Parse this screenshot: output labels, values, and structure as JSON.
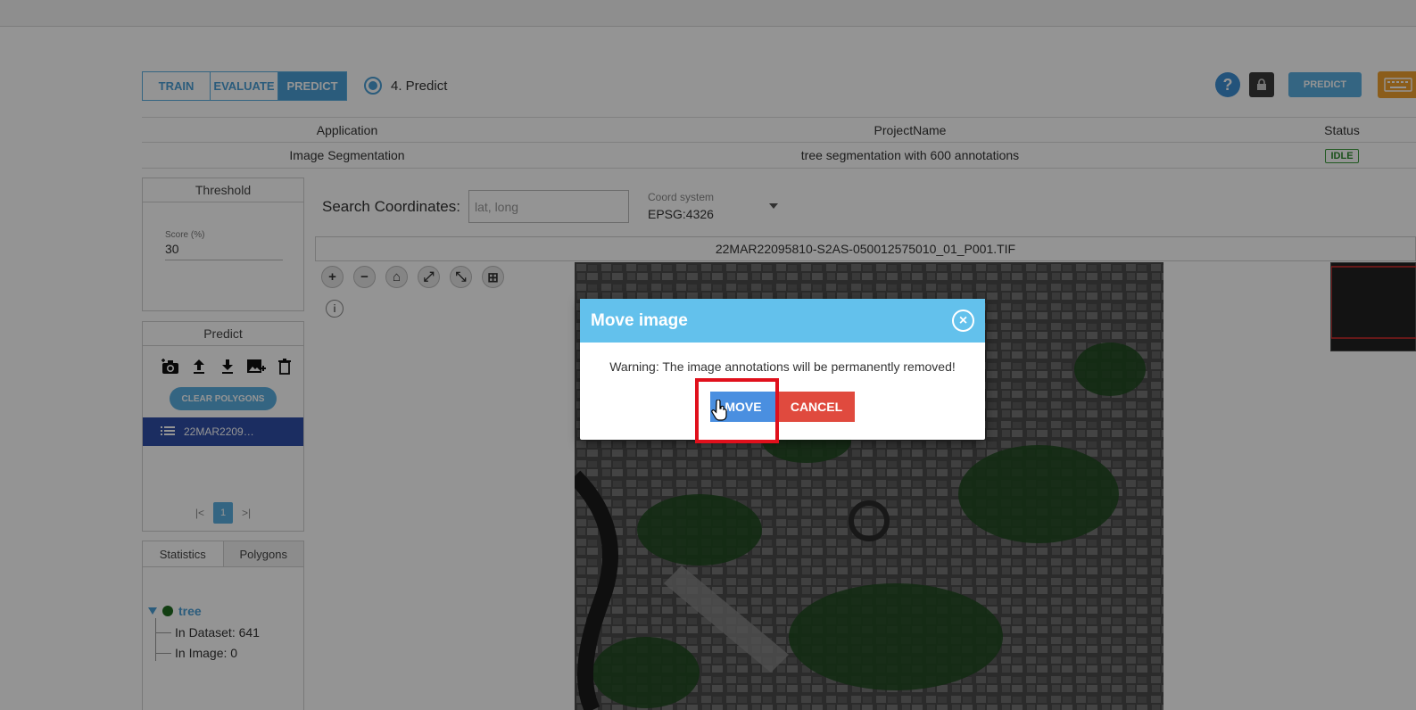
{
  "mode_tabs": [
    {
      "label": "TRAIN",
      "active": false
    },
    {
      "label": "EVALUATE",
      "active": false
    },
    {
      "label": "PREDICT",
      "active": true
    }
  ],
  "step_label": "4. Predict",
  "header_actions": {
    "help_glyph": "?",
    "lock_icon": "lock-icon",
    "predict_label": "PREDICT",
    "keyboard_icon": "keyboard-icon"
  },
  "project_table": {
    "headers": [
      "Application",
      "ProjectName",
      "Status"
    ],
    "row": {
      "application": "Image Segmentation",
      "project_name": "tree segmentation with 600 annotations",
      "status": "IDLE"
    }
  },
  "threshold": {
    "title": "Threshold",
    "score_label": "Score (%)",
    "score_value": "30"
  },
  "predict_panel": {
    "title": "Predict",
    "tool_icons": [
      "add-camera-icon",
      "upload-icon",
      "download-icon",
      "add-image-icon",
      "trash-icon"
    ],
    "clear_label": "CLEAR POLYGONS",
    "images": [
      "22MAR2209…"
    ],
    "pager": {
      "first": "|<",
      "current": "1",
      "last": ">|"
    }
  },
  "stats_panel": {
    "tabs": [
      "Statistics",
      "Polygons"
    ],
    "class_name": "tree",
    "class_color": "#1f6b1f",
    "in_dataset": "In Dataset: 641",
    "in_image": "In Image: 0"
  },
  "search": {
    "label": "Search Coordinates:",
    "placeholder": "lat, long",
    "coord_label": "Coord system",
    "coord_value": "EPSG:4326"
  },
  "viewer": {
    "filename": "22MAR22095810-S2AS-050012575010_01_P001.TIF",
    "zoom_tools": [
      "+",
      "−",
      "⌂",
      "⤢",
      "⤡",
      "⊞"
    ],
    "info_glyph": "i"
  },
  "dialog": {
    "title": "Move image",
    "message": "Warning: The image annotations will be permanently removed!",
    "move_label": "MOVE",
    "cancel_label": "CANCEL",
    "close_glyph": "×"
  },
  "colors": {
    "accent": "#4a9fd6",
    "dialog_header": "#63c1ec",
    "cancel": "#e04a3e",
    "highlight": "#e0101c"
  }
}
